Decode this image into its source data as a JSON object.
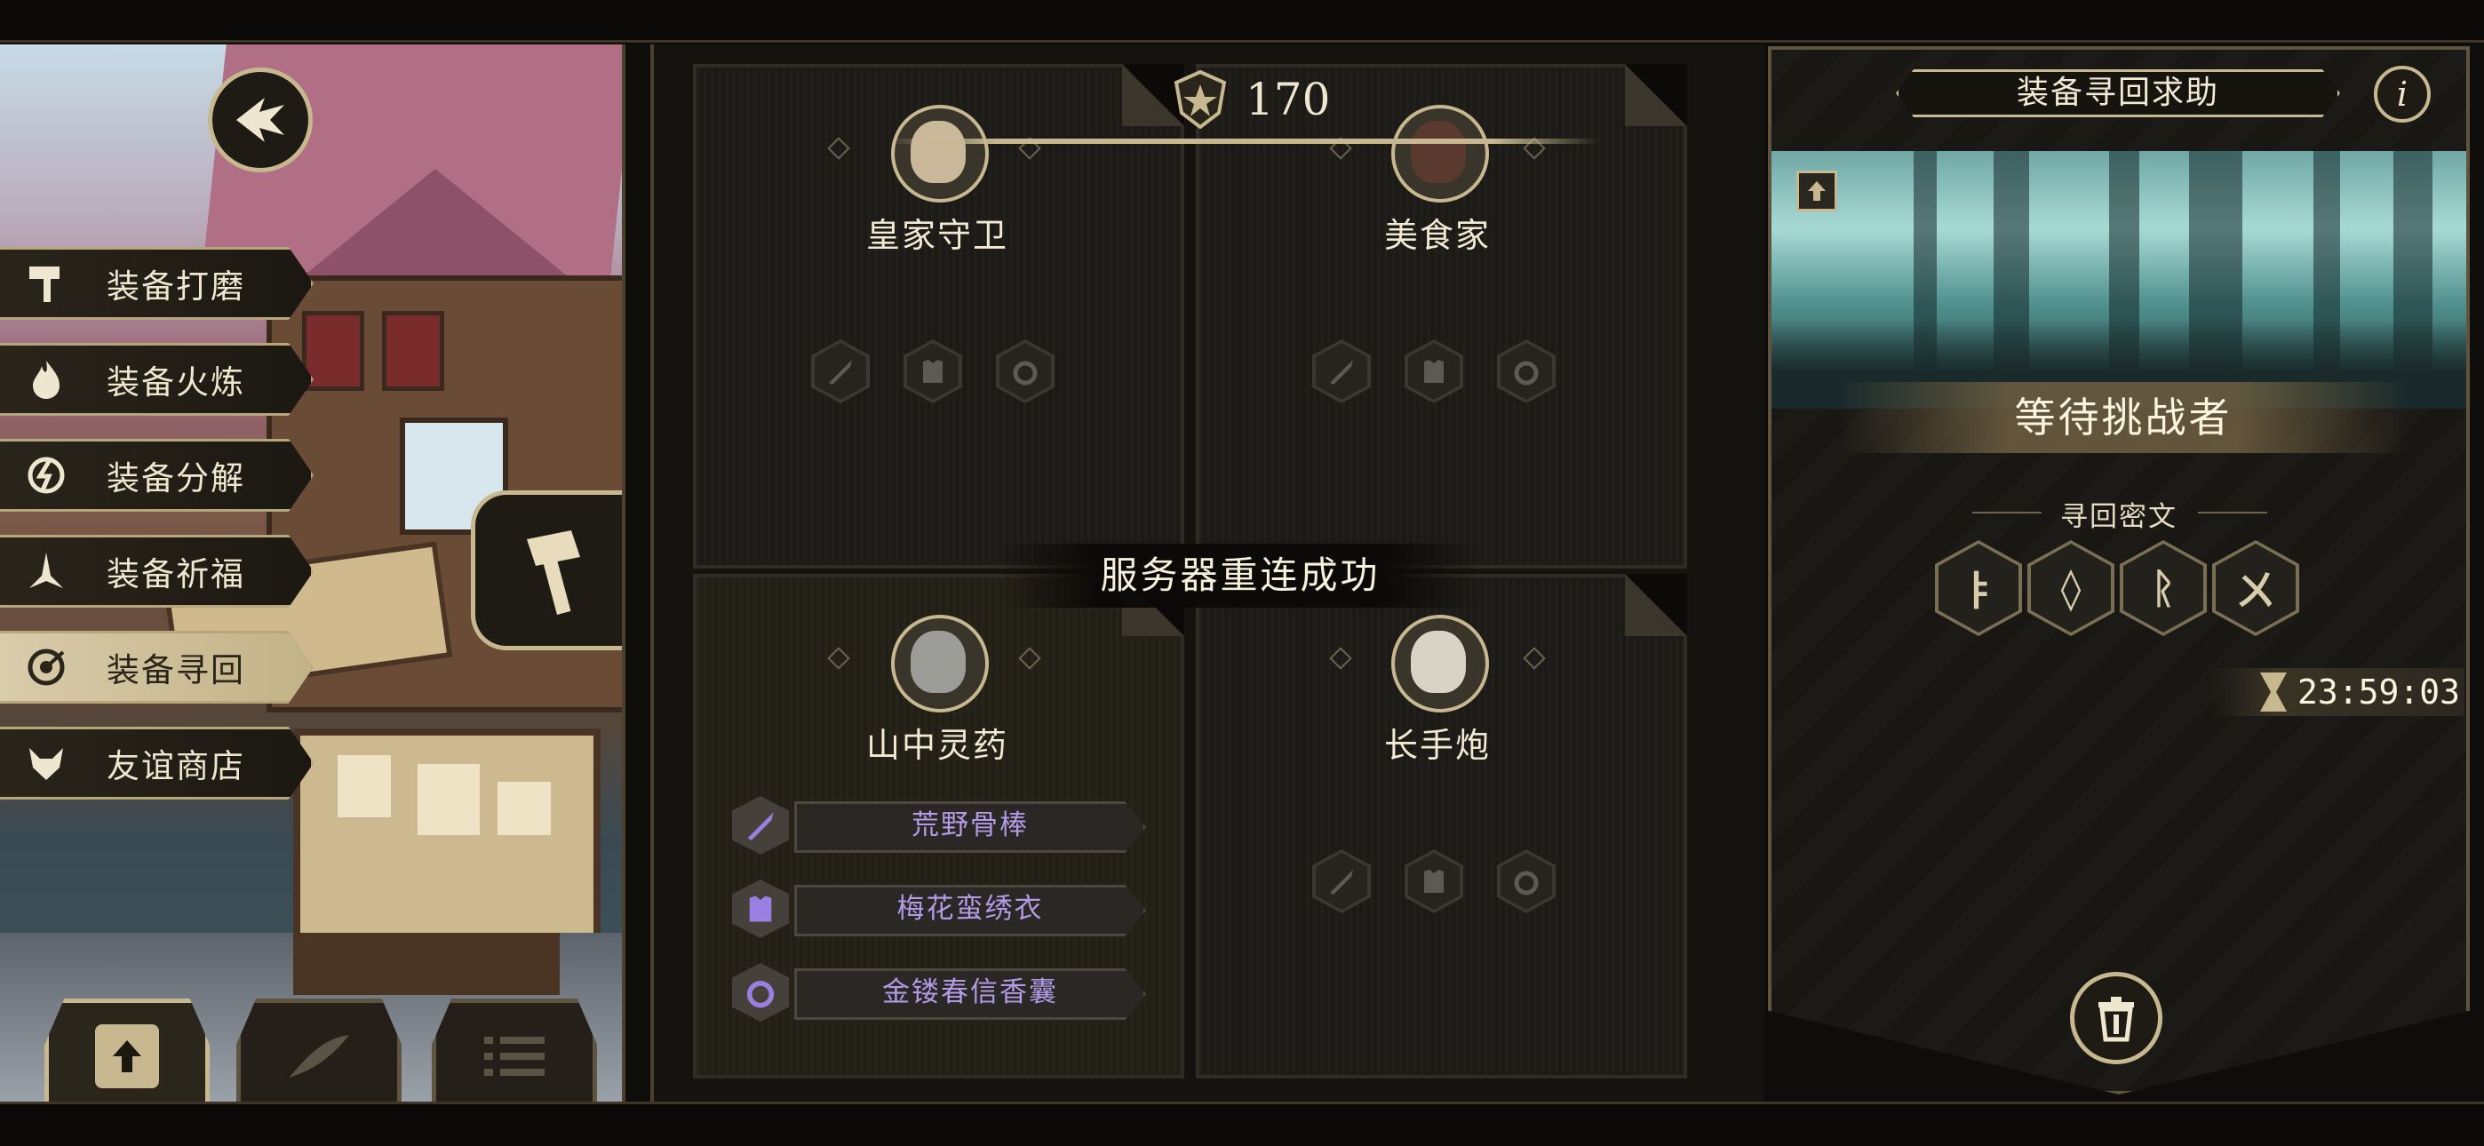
{
  "score": {
    "value": "170",
    "icon": "guild-crest-icon"
  },
  "toast": "服务器重连成功",
  "menu": [
    {
      "label": "装备打磨",
      "icon": "hammer-icon"
    },
    {
      "label": "装备火炼",
      "icon": "flame-icon"
    },
    {
      "label": "装备分解",
      "icon": "disassemble-icon"
    },
    {
      "label": "装备祈福",
      "icon": "pray-icon"
    },
    {
      "label": "装备寻回",
      "icon": "target-icon",
      "active": true
    },
    {
      "label": "友谊商店",
      "icon": "fox-icon"
    }
  ],
  "characters": [
    {
      "name": "皇家守卫",
      "items": []
    },
    {
      "name": "美食家",
      "items": []
    },
    {
      "name": "山中灵药",
      "items": [
        {
          "name": "荒野骨棒",
          "icon": "sword-icon"
        },
        {
          "name": "梅花蛮绣衣",
          "icon": "armor-icon"
        },
        {
          "name": "金镂春信香囊",
          "icon": "ring-icon"
        }
      ]
    },
    {
      "name": "长手炮",
      "items": []
    }
  ],
  "right_panel": {
    "title": "装备寻回求助",
    "info": "i",
    "status": "等待挑战者",
    "cipher_label": "寻回密文",
    "runes": [
      "ㅑ",
      "◊",
      "ᚱ",
      "ㄨ"
    ],
    "timer": "23:59:03"
  },
  "colors": {
    "gold": "#c7b88f",
    "purple_item": "#b39be8",
    "panel_bg": "#1b1a17"
  }
}
